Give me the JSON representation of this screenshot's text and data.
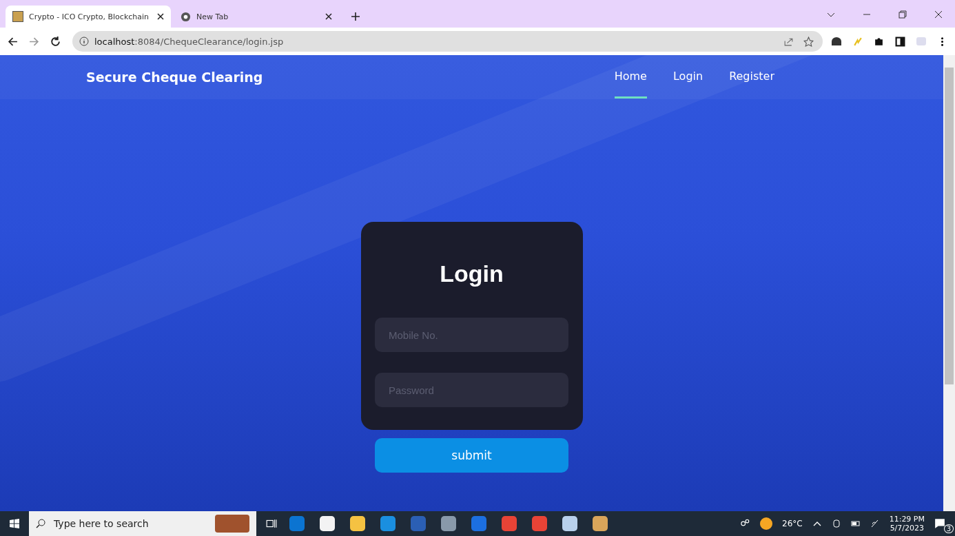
{
  "browser": {
    "tabs": [
      {
        "title": "Crypto - ICO Crypto, Blockchain",
        "selected": true
      },
      {
        "title": "New Tab",
        "selected": false
      }
    ],
    "url_host": "localhost",
    "url_path": ":8084/ChequeClearance/login.jsp"
  },
  "navbar": {
    "brand": "Secure Cheque Clearing",
    "links": [
      {
        "label": "Home",
        "selected": true
      },
      {
        "label": "Login",
        "selected": false
      },
      {
        "label": "Register",
        "selected": false
      }
    ]
  },
  "login_form": {
    "title": "Login",
    "fields": [
      {
        "placeholder": "Mobile No."
      },
      {
        "placeholder": "Password"
      }
    ],
    "submit": "submit"
  },
  "taskbar": {
    "search_placeholder": "Type here to search",
    "temperature": "26°C",
    "time": "11:29 PM",
    "date": "5/7/2023",
    "notification_count": "3"
  }
}
